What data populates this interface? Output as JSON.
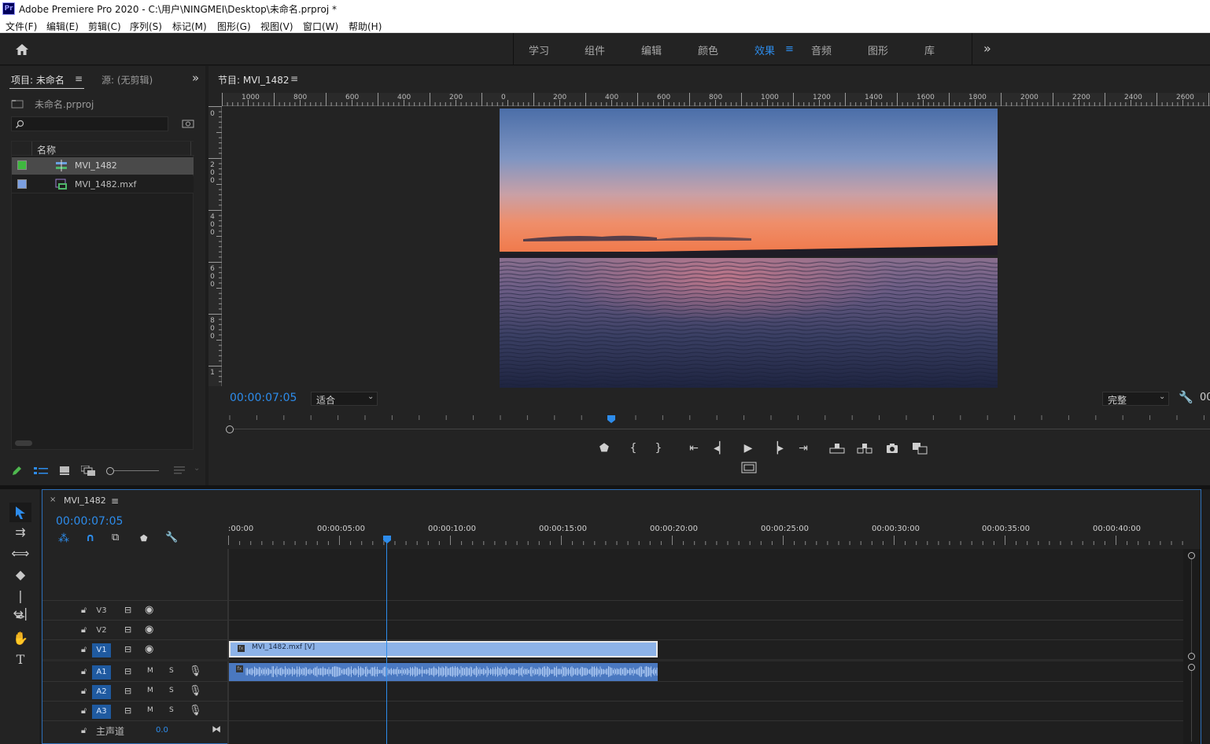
{
  "app": {
    "logo": "Pr",
    "title": "Adobe Premiere Pro 2020 - C:\\用户\\NINGMEI\\Desktop\\未命名.prproj *"
  },
  "menu": [
    "文件(F)",
    "编辑(E)",
    "剪辑(C)",
    "序列(S)",
    "标记(M)",
    "图形(G)",
    "视图(V)",
    "窗口(W)",
    "帮助(H)"
  ],
  "workspaces": {
    "items": [
      "学习",
      "组件",
      "编辑",
      "颜色",
      "效果",
      "音频",
      "图形",
      "库"
    ],
    "active": "效果",
    "overflow": "»"
  },
  "project": {
    "tab_label": "项目: 未命名",
    "source_tab": "源: (无剪辑)",
    "overflow": "»",
    "file_name": "未命名.prproj",
    "search_placeholder": "",
    "column_name": "名称",
    "items": [
      {
        "name": "MVI_1482",
        "color": "#3fb83f",
        "type": "sequence"
      },
      {
        "name": "MVI_1482.mxf",
        "color": "#7b9fe0",
        "type": "clip"
      }
    ]
  },
  "program": {
    "tab_label": "节目: MVI_1482",
    "timecode": "00:00:07:05",
    "fit_value": "适合",
    "quality_value": "完整",
    "right_timecode_stub": "00",
    "ruler_labels": [
      "1000",
      "800",
      "600",
      "400",
      "200",
      "0",
      "200",
      "400",
      "600",
      "800",
      "1000",
      "1200",
      "1400",
      "1600",
      "1800",
      "2000",
      "2200",
      "2400",
      "2600"
    ],
    "vruler_labels": [
      "0",
      "200",
      "400",
      "600",
      "800",
      "1"
    ],
    "playhead_fraction": 0.389
  },
  "timeline": {
    "tab_label": "MVI_1482",
    "close_glyph": "×",
    "timecode": "00:00:07:05",
    "time_labels": [
      ":00:00",
      "00:00:05:00",
      "00:00:10:00",
      "00:00:15:00",
      "00:00:20:00",
      "00:00:25:00",
      "00:00:30:00",
      "00:00:35:00",
      "00:00:40:00"
    ],
    "video_tracks": [
      "V3",
      "V2",
      "V1"
    ],
    "audio_tracks": [
      "A1",
      "A2",
      "A3"
    ],
    "mute_label": "M",
    "solo_label": "S",
    "master_label": "主声道",
    "master_value": "0.0",
    "clip_video_label": "MVI_1482.mxf [V]",
    "clip_fx_label": "fx",
    "colors": {
      "accent": "#2d8ceb",
      "clip_video": "#8db3e8",
      "clip_audio": "#4a78c0",
      "track_on": "#1f5aa0"
    }
  }
}
